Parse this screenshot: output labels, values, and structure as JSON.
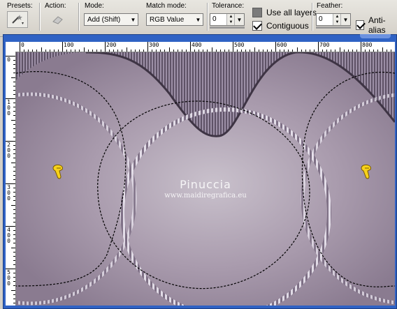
{
  "toolbar": {
    "presets_label": "Presets:",
    "action_label": "Action:",
    "mode_label": "Mode:",
    "mode_value": "Add (Shift)",
    "match_label": "Match mode:",
    "match_value": "RGB Value",
    "tolerance_label": "Tolerance:",
    "tolerance_value": "0",
    "use_all_layers_label": "Use all layers",
    "use_all_layers_checked": false,
    "contiguous_label": "Contiguous",
    "contiguous_checked": true,
    "feather_label": "Feather:",
    "feather_value": "0",
    "anti_alias_label": "Anti-alias",
    "anti_alias_checked": true
  },
  "ruler": {
    "h_labels": [
      "0",
      "100",
      "200",
      "300",
      "400",
      "500",
      "600",
      "700",
      "800"
    ],
    "v_labels": [
      "0",
      "100",
      "200",
      "300",
      "400",
      "500"
    ]
  },
  "canvas": {
    "watermark_title": "Pinuccia",
    "watermark_url": "www.maidiregrafica.eu",
    "colors": {
      "base": "#a89aac",
      "stripe_dark": "#5e5266",
      "stripe_light": "#9c8fa6",
      "ring": "#ddd6e2",
      "hand": "#f7d21a"
    }
  }
}
